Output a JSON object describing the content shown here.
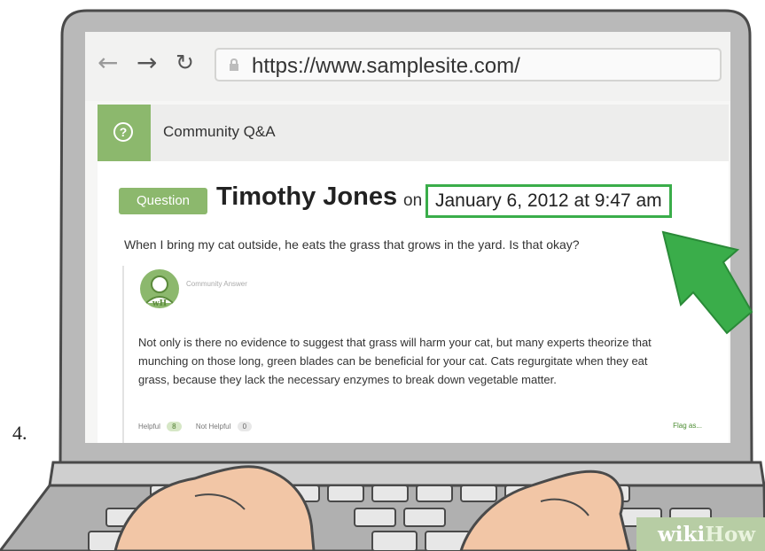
{
  "step_number": "4.",
  "browser": {
    "back_icon": "back-arrow-icon",
    "forward_icon": "forward-arrow-icon",
    "reload_icon": "reload-icon",
    "url": "https://www.samplesite.com/"
  },
  "qa_header": {
    "icon": "question-circle-icon",
    "title": "Community Q&A"
  },
  "question": {
    "badge": "Question",
    "author": "Timothy Jones",
    "on": "on",
    "date": "January 6, 2012 at 9:47 am",
    "text": "When I bring my cat outside, he eats the grass that grows in the yard. Is that okay?"
  },
  "answer": {
    "avatar_text": "wH",
    "label": "Community Answer",
    "text": "Not only is there no evidence to suggest that grass will harm your cat, but many experts theorize that munching on those long, green blades can be beneficial for your cat. Cats regurgitate when they eat grass, because they lack the necessary enzymes to break down vegetable matter.",
    "helpful_label": "Helpful",
    "helpful_count": "8",
    "not_helpful_label": "Not Helpful",
    "not_helpful_count": "0",
    "flag": "Flag as..."
  },
  "watermark": {
    "part1": "wiki",
    "part2": "How"
  },
  "colors": {
    "accent_green": "#8cb86d",
    "highlight_green": "#3aad4a",
    "laptop_gray": "#b9b9b9"
  }
}
